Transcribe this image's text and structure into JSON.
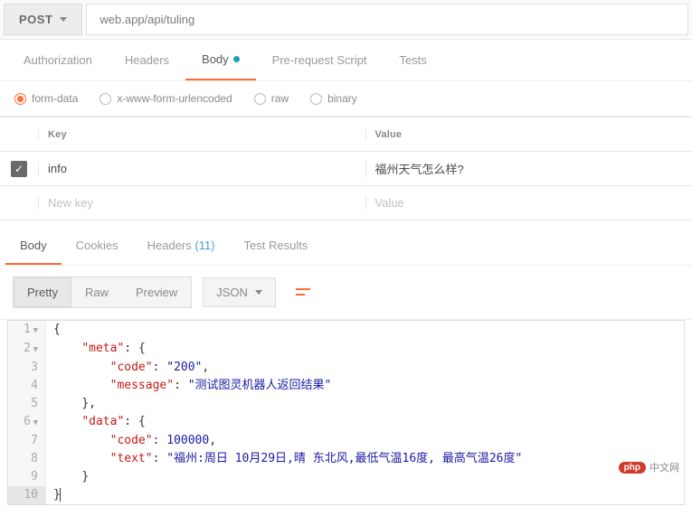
{
  "request": {
    "method": "POST",
    "url": "web.app/api/tuling"
  },
  "request_tabs": [
    {
      "label": "Authorization"
    },
    {
      "label": "Headers"
    },
    {
      "label": "Body",
      "active": true,
      "has_indicator": true
    },
    {
      "label": "Pre-request Script"
    },
    {
      "label": "Tests"
    }
  ],
  "body_types": [
    {
      "label": "form-data",
      "selected": true
    },
    {
      "label": "x-www-form-urlencoded",
      "selected": false
    },
    {
      "label": "raw",
      "selected": false
    },
    {
      "label": "binary",
      "selected": false
    }
  ],
  "params_table": {
    "headers": {
      "key": "Key",
      "value": "Value"
    },
    "rows": [
      {
        "enabled": true,
        "key": "info",
        "value": "福州天气怎么样?"
      }
    ],
    "new_row": {
      "key_placeholder": "New key",
      "value_placeholder": "Value"
    }
  },
  "response_tabs": [
    {
      "label": "Body",
      "active": true
    },
    {
      "label": "Cookies"
    },
    {
      "label": "Headers",
      "count": "(11)"
    },
    {
      "label": "Test Results"
    }
  ],
  "view_modes": [
    {
      "label": "Pretty",
      "active": true
    },
    {
      "label": "Raw"
    },
    {
      "label": "Preview"
    }
  ],
  "format_select": "JSON",
  "response_body": {
    "meta": {
      "code": "200",
      "message": "测试图灵机器人返回结果"
    },
    "data": {
      "code": 100000,
      "text": "福州:周日 10月29日,晴 东北风,最低气温16度, 最高气温26度"
    }
  },
  "code_lines": [
    {
      "n": 1,
      "fold": true,
      "indent": 0,
      "tokens": [
        {
          "t": "brace",
          "v": "{"
        }
      ]
    },
    {
      "n": 2,
      "fold": true,
      "indent": 1,
      "tokens": [
        {
          "t": "key",
          "v": "\"meta\""
        },
        {
          "t": "punc",
          "v": ": "
        },
        {
          "t": "brace",
          "v": "{"
        }
      ]
    },
    {
      "n": 3,
      "indent": 2,
      "tokens": [
        {
          "t": "key",
          "v": "\"code\""
        },
        {
          "t": "punc",
          "v": ": "
        },
        {
          "t": "str",
          "v": "\"200\""
        },
        {
          "t": "punc",
          "v": ","
        }
      ]
    },
    {
      "n": 4,
      "indent": 2,
      "tokens": [
        {
          "t": "key",
          "v": "\"message\""
        },
        {
          "t": "punc",
          "v": ": "
        },
        {
          "t": "str",
          "v": "\"测试图灵机器人返回结果\""
        }
      ]
    },
    {
      "n": 5,
      "indent": 1,
      "tokens": [
        {
          "t": "brace",
          "v": "}"
        },
        {
          "t": "punc",
          "v": ","
        }
      ]
    },
    {
      "n": 6,
      "fold": true,
      "indent": 1,
      "tokens": [
        {
          "t": "key",
          "v": "\"data\""
        },
        {
          "t": "punc",
          "v": ": "
        },
        {
          "t": "brace",
          "v": "{"
        }
      ]
    },
    {
      "n": 7,
      "indent": 2,
      "tokens": [
        {
          "t": "key",
          "v": "\"code\""
        },
        {
          "t": "punc",
          "v": ": "
        },
        {
          "t": "num",
          "v": "100000"
        },
        {
          "t": "punc",
          "v": ","
        }
      ]
    },
    {
      "n": 8,
      "indent": 2,
      "tokens": [
        {
          "t": "key",
          "v": "\"text\""
        },
        {
          "t": "punc",
          "v": ": "
        },
        {
          "t": "str",
          "v": "\"福州:周日 10月29日,晴 东北风,最低气温16度, 最高气温26度\""
        }
      ]
    },
    {
      "n": 9,
      "indent": 1,
      "tokens": [
        {
          "t": "brace",
          "v": "}"
        }
      ]
    },
    {
      "n": 10,
      "last": true,
      "indent": 0,
      "tokens": [
        {
          "t": "brace",
          "v": "}"
        },
        {
          "t": "cursor",
          "v": ""
        }
      ]
    }
  ],
  "watermark": {
    "badge": "php",
    "text": "中文网"
  }
}
